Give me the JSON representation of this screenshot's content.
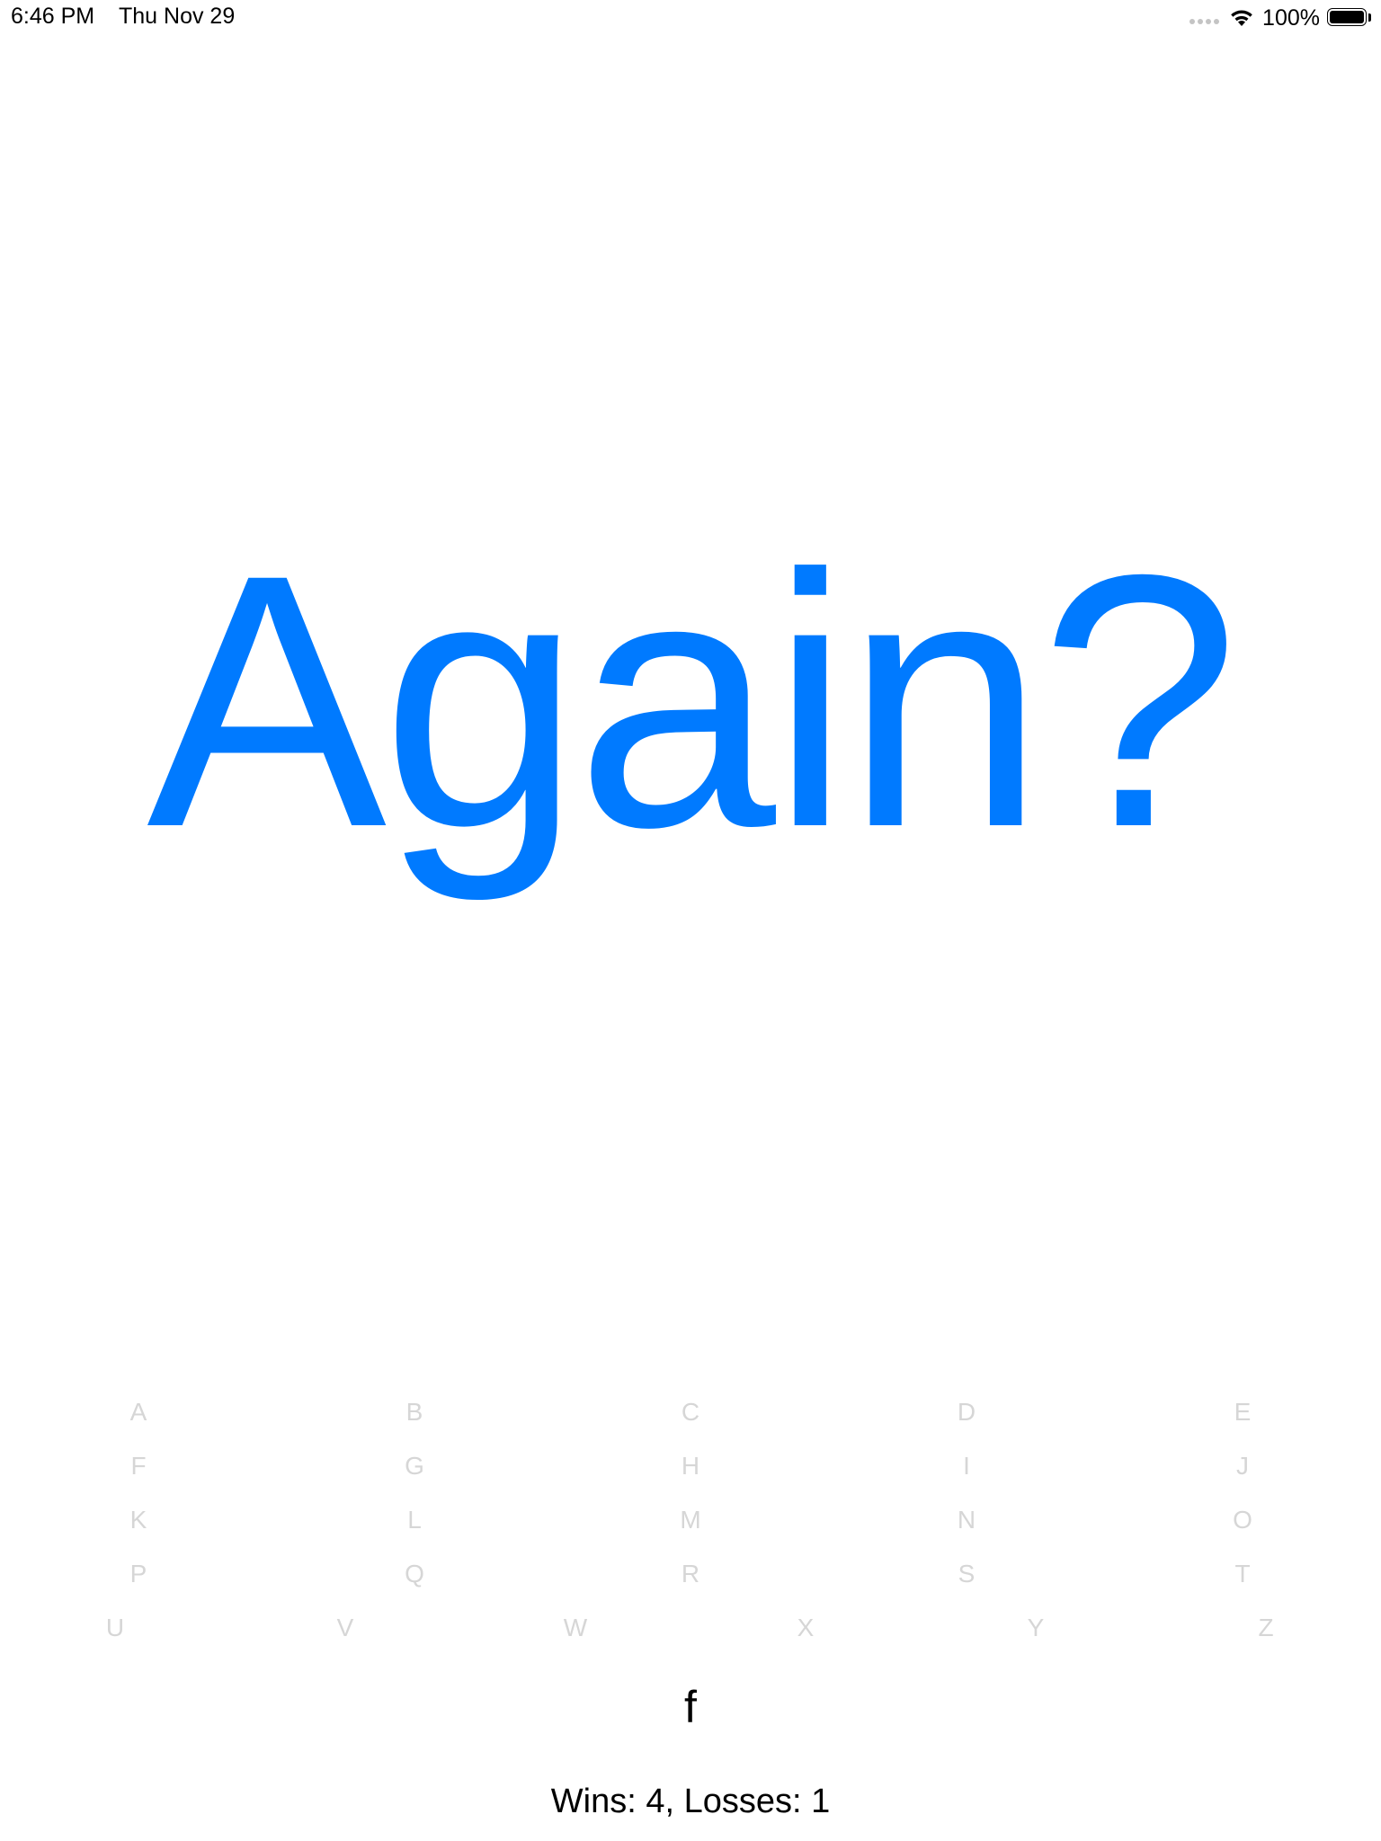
{
  "status_bar": {
    "time": "6:46 PM",
    "date": "Thu Nov 29",
    "battery_percent": "100%",
    "wifi_icon": "wifi-icon",
    "battery_icon": "battery-full-icon"
  },
  "game": {
    "prompt": "Again?",
    "prompt_color": "#007aff",
    "letters": [
      "A",
      "B",
      "C",
      "D",
      "E",
      "F",
      "G",
      "H",
      "I",
      "J",
      "K",
      "L",
      "M",
      "N",
      "O",
      "P",
      "Q",
      "R",
      "S",
      "T",
      "U",
      "V",
      "W",
      "X",
      "Y",
      "Z"
    ],
    "letter_color": "#d6d6d6",
    "current_guess": "f",
    "score": "Wins: 4, Losses: 1"
  }
}
